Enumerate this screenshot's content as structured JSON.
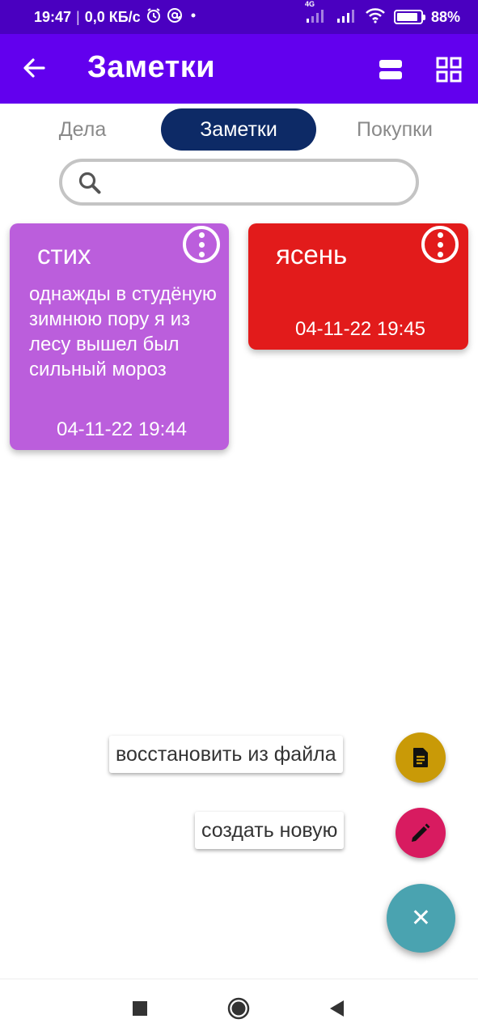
{
  "colors": {
    "status_bar": "#4a00c0",
    "app_bar": "#6200ee",
    "active_tab": "#0d2a66",
    "note_purple": "#bb5edc",
    "note_red": "#e21b1b",
    "fab_file": "#c99a07",
    "fab_create": "#d81b60",
    "fab_main": "#4aa3b0"
  },
  "status_bar": {
    "time": "19:47",
    "speed": "0,0 КБ/с",
    "network": "4G",
    "battery": "88%",
    "battery_level": 0.88,
    "icons": [
      "alarm-icon",
      "at-icon",
      "dot-icon",
      "signal-icon",
      "signal-icon",
      "wifi-icon",
      "battery-icon"
    ]
  },
  "app_bar": {
    "title": "Заметки",
    "icons": [
      "arrow-back-icon",
      "view-list-icon",
      "view-grid-icon"
    ]
  },
  "tabs": [
    {
      "label": "Дела",
      "active": false
    },
    {
      "label": "Заметки",
      "active": true
    },
    {
      "label": "Покупки",
      "active": false
    }
  ],
  "search": {
    "placeholder": "",
    "value": "",
    "icon": "search-icon"
  },
  "notes": [
    {
      "title": "стих",
      "body": "однажды в студёную зимнюю пору я из лесу вышел был сильный мороз",
      "date": "04-11-22 19:44",
      "color": "#bb5edc",
      "menu_icon": "more-vert-icon"
    },
    {
      "title": "ясень",
      "body": "",
      "date": "04-11-22 19:45",
      "color": "#e21b1b",
      "menu_icon": "more-vert-icon"
    }
  ],
  "fab_menu": {
    "restore_label": "восстановить из файла",
    "restore_icon": "document-icon",
    "create_label": "создать новую",
    "create_icon": "pencil-icon",
    "main_icon": "close-icon",
    "main_glyph": "✕"
  },
  "nav_bar": {
    "icons": [
      "recents-icon",
      "home-icon",
      "back-icon"
    ]
  }
}
